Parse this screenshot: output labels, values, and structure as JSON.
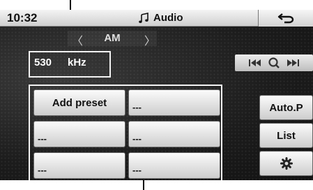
{
  "status_bar": {
    "time": "10:32",
    "title": "Audio"
  },
  "band": {
    "label": "AM"
  },
  "frequency": {
    "value": "530",
    "unit": "kHz"
  },
  "presets": [
    {
      "label": "Add preset"
    },
    {
      "label": "---"
    },
    {
      "label": "---"
    },
    {
      "label": "---"
    },
    {
      "label": "---"
    },
    {
      "label": "---"
    }
  ],
  "side_buttons": {
    "auto_preset": "Auto.P",
    "list": "List"
  },
  "icons": {
    "title": "music-note-icon",
    "back": "back-arrow-icon",
    "seek_back": "seek-back-icon",
    "scan": "search-icon",
    "seek_forward": "seek-forward-icon",
    "settings": "gear-icon"
  }
}
